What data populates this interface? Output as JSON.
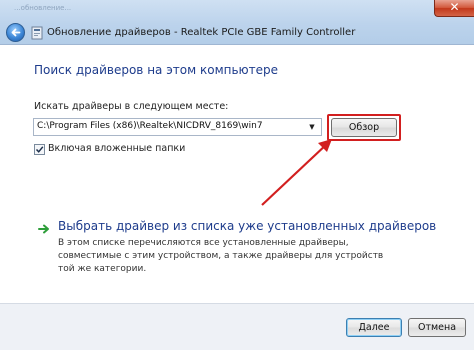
{
  "window": {
    "faded_title": "...обновление...",
    "title": "Обновление драйверов - Realtek PCIe GBE Family Controller",
    "close_glyph": "✕"
  },
  "page": {
    "heading": "Поиск драйверов на этом компьютере",
    "search_label": "Искать драйверы в следующем месте:",
    "path_value": "C:\\Program Files (x86)\\Realtek\\NICDRV_8169\\win7",
    "dropdown_glyph": "▼",
    "browse_label": "Обзор",
    "include_subfolders_label": "Включая вложенные папки",
    "include_subfolders_checked": true,
    "pick_link_title": "Выбрать драйвер из списка уже установленных драйверов",
    "pick_link_description": "В этом списке перечисляются все установленные драйверы, совместимые с этим устройством, а также драйверы для устройств той же категории."
  },
  "footer": {
    "next_label": "Далее",
    "cancel_label": "Отмена"
  },
  "colors": {
    "heading": "#1e3c8c",
    "annotation_red": "#d21f1f",
    "link_arrow_green": "#2e9e3a",
    "titlebar": "#bcd3ec"
  },
  "icons": [
    "back-arrow-icon",
    "device-icon",
    "close-icon",
    "green-arrow-icon",
    "checkmark-icon",
    "dropdown-arrow-icon"
  ]
}
